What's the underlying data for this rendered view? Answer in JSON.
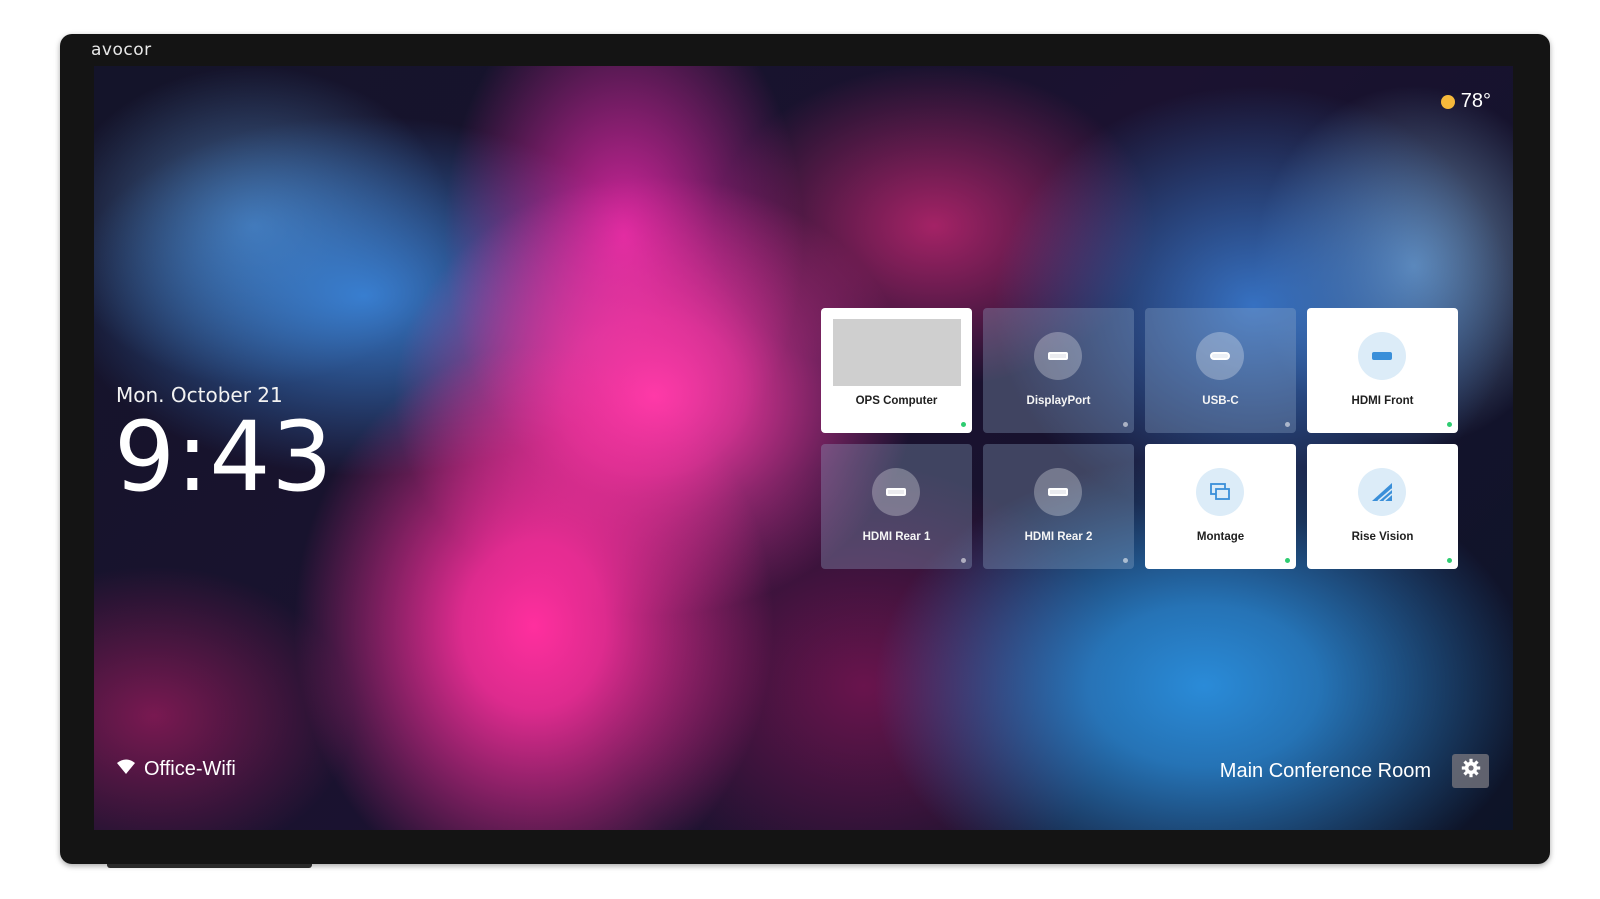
{
  "brand": "avocor",
  "weather": {
    "temperature": "78°",
    "icon": "sun-icon",
    "icon_color": "#f6b93b"
  },
  "clock": {
    "date": "Mon. October 21",
    "time": "9:43"
  },
  "sources": [
    {
      "label": "OPS Computer",
      "style": "light",
      "icon": "preview-thumbnail",
      "status": "active"
    },
    {
      "label": "DisplayPort",
      "style": "glass",
      "icon": "displayport-icon",
      "status": "inactive"
    },
    {
      "label": "USB-C",
      "style": "glass",
      "icon": "usb-c-icon",
      "status": "inactive"
    },
    {
      "label": "HDMI Front",
      "style": "light",
      "icon": "hdmi-icon",
      "status": "active"
    },
    {
      "label": "HDMI Rear 1",
      "style": "glass",
      "icon": "hdmi-icon",
      "status": "inactive"
    },
    {
      "label": "HDMI Rear 2",
      "style": "glass",
      "icon": "hdmi-icon",
      "status": "inactive"
    },
    {
      "label": "Montage",
      "style": "light",
      "icon": "montage-icon",
      "status": "active"
    },
    {
      "label": "Rise Vision",
      "style": "light",
      "icon": "rise-vision-icon",
      "status": "active"
    }
  ],
  "network": {
    "icon": "wifi-icon",
    "name": "Office-Wifi"
  },
  "room": {
    "name": "Main Conference Room"
  },
  "settings": {
    "icon": "gear-icon"
  },
  "colors": {
    "accent_blue": "#3a8fd9",
    "status_green": "#2ecc71",
    "bezel": "#141414"
  }
}
